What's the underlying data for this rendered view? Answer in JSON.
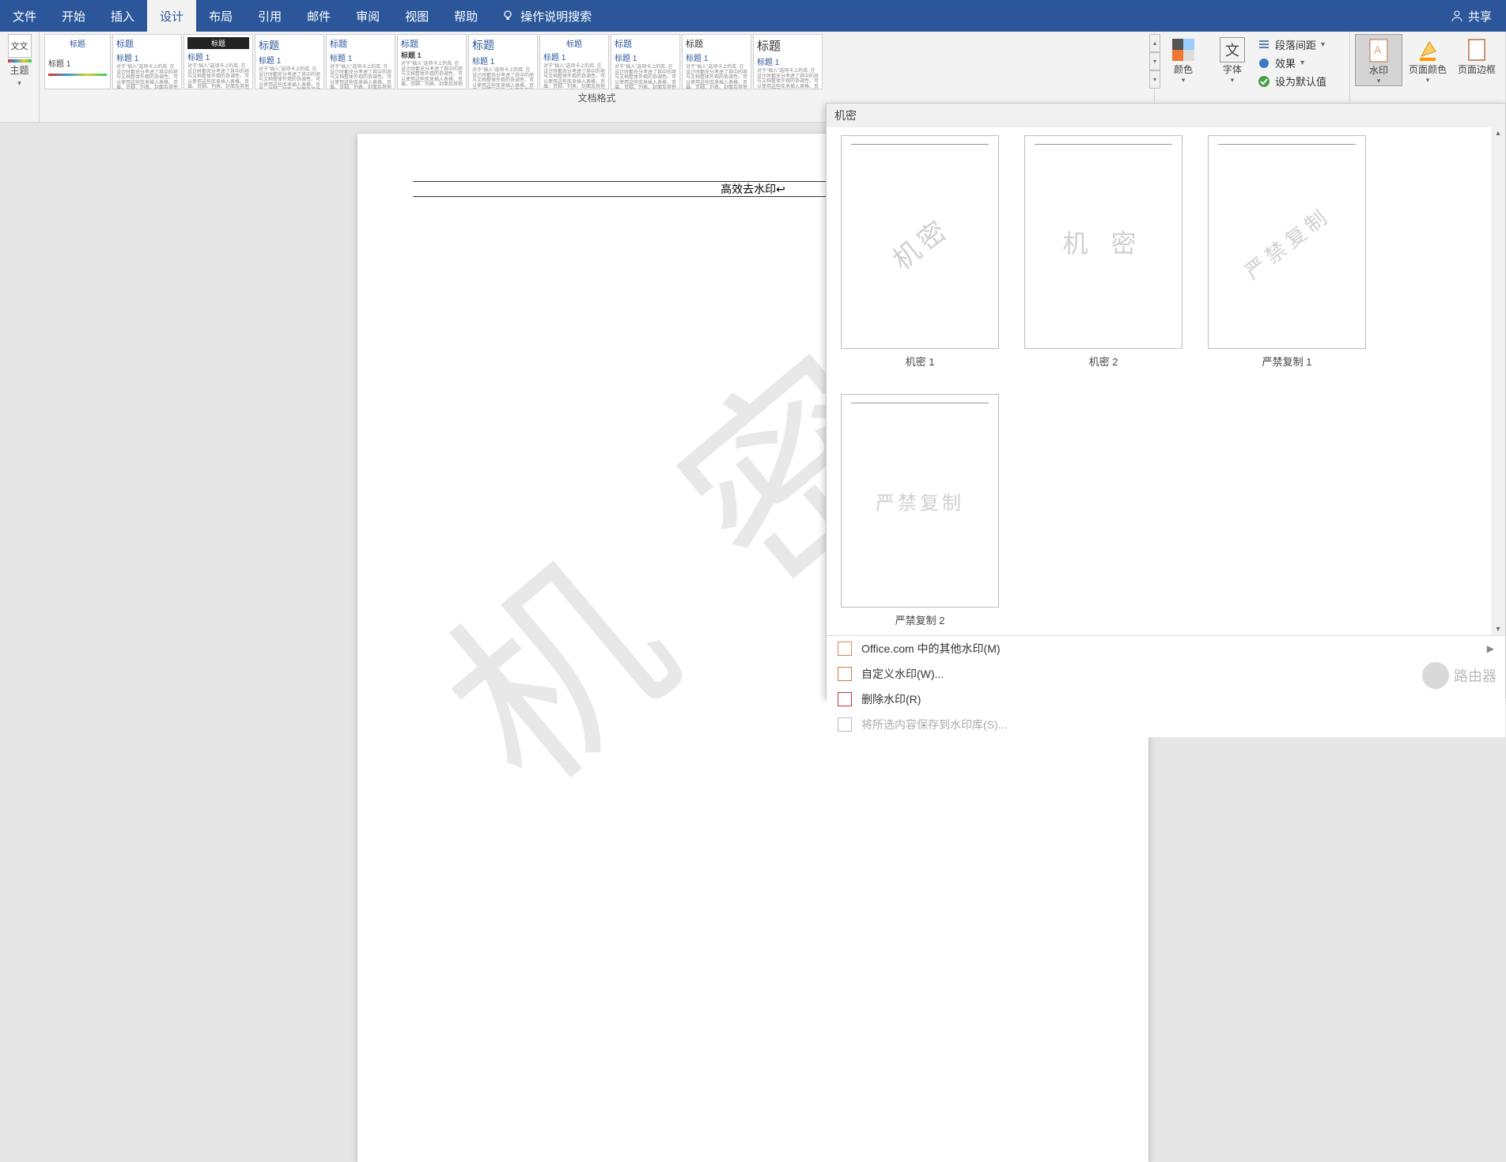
{
  "menu": {
    "tabs": [
      "文件",
      "开始",
      "插入",
      "设计",
      "布局",
      "引用",
      "邮件",
      "审阅",
      "视图",
      "帮助"
    ],
    "search": "操作说明搜索",
    "share": "共享"
  },
  "ribbon": {
    "theme": "主题",
    "style_title": "标题",
    "style_sub": "标题 1",
    "style_body": "对于\"插入\"选项卡上的库, 在设计时都充分考虑了其中的项与文档整体外观的协调性。可以使用这些库来插入表格、页眉、页脚、列表、封面及其他",
    "gallery_label": "文档格式",
    "colors": "颜色",
    "fonts": "字体",
    "font_char": "文",
    "para": "段落间距",
    "effects": "效果",
    "setdefault": "设为默认值",
    "watermark": "水印",
    "pagecolor": "页面颜色",
    "pageborder": "页面边框"
  },
  "page": {
    "header_text": "高效去水印↩",
    "wm_main": "机 密"
  },
  "panel": {
    "header": "机密",
    "items": [
      {
        "text": "机密",
        "style": "diag",
        "label": "机密 1"
      },
      {
        "text": "机 密",
        "style": "horiz",
        "label": "机密 2"
      },
      {
        "text": "严禁复制",
        "style": "diag",
        "label": "严禁复制 1"
      },
      {
        "text": "严禁复制",
        "style": "horiz",
        "label": "严禁复制 2"
      }
    ],
    "menu": {
      "more": "Office.com 中的其他水印(M)",
      "custom": "自定义水印(W)...",
      "remove": "删除水印(R)",
      "save": "将所选内容保存到水印库(S)..."
    }
  },
  "logo_text": "路由器"
}
